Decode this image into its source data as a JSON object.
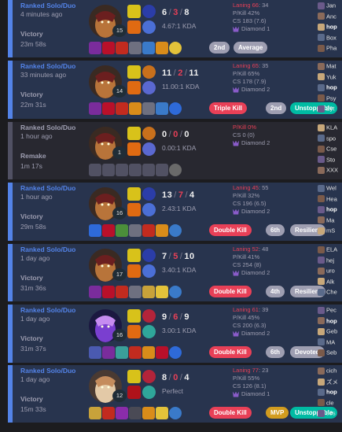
{
  "matches": [
    {
      "mode": "Ranked Solo/Duo",
      "ago": "4 minutes ago",
      "result": "Victory",
      "duration": "23m 58s",
      "level": "15",
      "kills": "6",
      "deaths": "3",
      "assists": "8",
      "ratio": "4.67:1 KDA",
      "laning": "Laning 66",
      "laning_score": ": 34",
      "pkill": "P/Kill 42%",
      "cs": "CS 183 (7.6)",
      "rank": "Diamond 1",
      "badges": [
        "2nd",
        "Average"
      ],
      "players": [
        "Jan",
        "Anc",
        "hop",
        "Box",
        "Pha"
      ]
    },
    {
      "mode": "Ranked Solo/Duo",
      "ago": "33 minutes ago",
      "result": "Victory",
      "duration": "22m 31s",
      "level": "14",
      "kills": "11",
      "deaths": "2",
      "assists": "11",
      "ratio": "11.00:1 KDA",
      "laning": "Laning 65",
      "laning_score": ": 35",
      "pkill": "P/Kill 65%",
      "cs": "CS 178 (7.9)",
      "rank": "Diamond 2",
      "badges": [
        "Triple Kill",
        "2nd",
        "Unstoppable"
      ],
      "players": [
        "Mat",
        "Yuk",
        "hop",
        "Psy",
        "Zyt"
      ]
    },
    {
      "mode": "Ranked Solo/Duo",
      "ago": "1 hour ago",
      "result": "Remake",
      "duration": "1m 17s",
      "level": "1",
      "kills": "0",
      "deaths": "0",
      "assists": "0",
      "ratio": "0.00:1 KDA",
      "laning": "",
      "laning_score": "",
      "pkill": "P/Kill 0%",
      "cs": "CS 0 (0)",
      "rank": "Diamond 2",
      "badges": [],
      "players": [
        "KLA",
        "spo",
        "Cse",
        "Sto",
        "XXX"
      ]
    },
    {
      "mode": "Ranked Solo/Duo",
      "ago": "1 hour ago",
      "result": "Victory",
      "duration": "29m 58s",
      "level": "16",
      "kills": "13",
      "deaths": "7",
      "assists": "4",
      "ratio": "2.43:1 KDA",
      "laning": "Laning 45",
      "laning_score": ": 55",
      "pkill": "P/Kill 32%",
      "cs": "CS 196 (6.5)",
      "rank": "Diamond 2",
      "badges": [
        "Double Kill",
        "6th",
        "Resilient"
      ],
      "players": [
        "Wel",
        "Hea",
        "hop",
        "Ma",
        "mS"
      ]
    },
    {
      "mode": "Ranked Solo/Duo",
      "ago": "1 day ago",
      "result": "Victory",
      "duration": "31m 36s",
      "level": "17",
      "kills": "7",
      "deaths": "5",
      "assists": "10",
      "ratio": "3.40:1 KDA",
      "laning": "Laning 52",
      "laning_score": ": 48",
      "pkill": "P/Kill 41%",
      "cs": "CS 254 (8)",
      "rank": "Diamond 2",
      "badges": [
        "Double Kill",
        "4th",
        "Resilient"
      ],
      "players": [
        "ELA",
        "hej",
        "uro",
        "Alk",
        "Che"
      ]
    },
    {
      "mode": "Ranked Solo/Duo",
      "ago": "1 day ago",
      "result": "Victory",
      "duration": "31m 37s",
      "level": "16",
      "kills": "9",
      "deaths": "6",
      "assists": "9",
      "ratio": "3.00:1 KDA",
      "laning": "Laning 61",
      "laning_score": ": 39",
      "pkill": "P/Kill 45%",
      "cs": "CS 200 (6.3)",
      "rank": "Diamond 2",
      "badges": [
        "Double Kill",
        "6th",
        "Devoted"
      ],
      "players": [
        "Pec",
        "hop",
        "Geb",
        "MA",
        "Seb"
      ]
    },
    {
      "mode": "Ranked Solo/Duo",
      "ago": "1 day ago",
      "result": "Victory",
      "duration": "15m 33s",
      "level": "12",
      "kills": "8",
      "deaths": "0",
      "assists": "4",
      "ratio": "Perfect",
      "laning": "Laning 77",
      "laning_score": ": 23",
      "pkill": "P/Kill 55%",
      "cs": "CS 126 (8.1)",
      "rank": "Diamond 1",
      "badges": [
        "Double Kill",
        "MVP",
        "Unstoppable"
      ],
      "players": [
        "cich",
        "ズメ",
        "hop",
        "cle",
        "Jos"
      ]
    }
  ],
  "colors": {
    "win_bg": "#28344e",
    "win_accent": "#5383e8",
    "remake_bg": "#282830",
    "remake_accent": "#515163",
    "death_red": "#e84057",
    "badge_gray": "#9e9eb1",
    "badge_red": "#e84057",
    "badge_green": "#00bba3",
    "badge_gold": "#d29c1f"
  },
  "icons": [
    "champion-portrait-icon",
    "flash-summoner-icon",
    "ignite-summoner-icon",
    "keystone-rune-icon",
    "secondary-rune-icon",
    "item-icon",
    "trinket-icon",
    "player-avatar-icon",
    "rank-emblem-icon"
  ]
}
